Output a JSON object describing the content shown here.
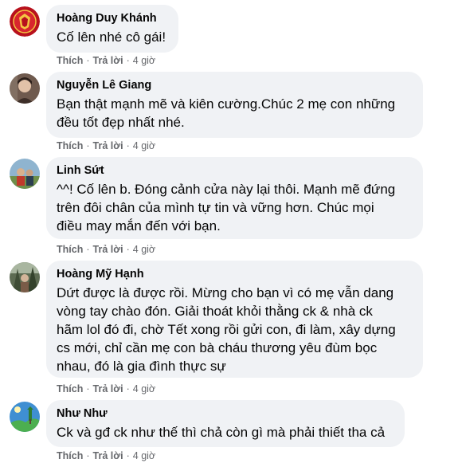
{
  "comments": [
    {
      "author": "Hoàng Duy Khánh",
      "lines": [
        "Cố lên nhé cô gái!"
      ],
      "like": "Thích",
      "reply": "Trả lời",
      "time": "4 giờ",
      "avatar": "team-crest-avatar"
    },
    {
      "author": "Nguyễn Lê Giang",
      "lines": [
        "Bạn thật mạnh mẽ và kiên cường.Chúc 2 mẹ con những",
        "đều tốt đẹp nhất nhé."
      ],
      "like": "Thích",
      "reply": "Trả lời",
      "time": "4 giờ",
      "avatar": "person-photo-avatar"
    },
    {
      "author": "Linh Sứt",
      "lines": [
        "^^! Cố lên b. Đóng cảnh cửa này lại thôi. Mạnh mẽ đứng",
        "trên đôi chân của mình tự tin và vững hơn. Chúc mọi",
        "điều may mắn đến với bạn."
      ],
      "like": "Thích",
      "reply": "Trả lời",
      "time": "4 giờ",
      "avatar": "outdoor-photo-avatar"
    },
    {
      "author": "Hoàng Mỹ Hạnh",
      "lines": [
        "Dứt được là được rồi. Mừng cho bạn vì có mẹ vẫn dang",
        "vòng tay chào đón. Giải thoát khỏi thằng ck & nhà ck",
        "hãm lol đó đi, chờ Tết xong rồi gửi con, đi làm, xây dựng",
        "cs mới, chỉ cần mẹ con bà cháu thương yêu đùm bọc",
        "nhau, đó là gia đình thực sự"
      ],
      "like": "Thích",
      "reply": "Trả lời",
      "time": "4 giờ",
      "avatar": "forest-photo-avatar"
    },
    {
      "author": "Như Như",
      "lines": [
        "Ck và gđ ck như thế thì chả còn gì mà phải thiết tha cả"
      ],
      "like": "Thích",
      "reply": "Trả lời",
      "time": "4 giờ",
      "avatar": "landscape-photo-avatar"
    }
  ]
}
